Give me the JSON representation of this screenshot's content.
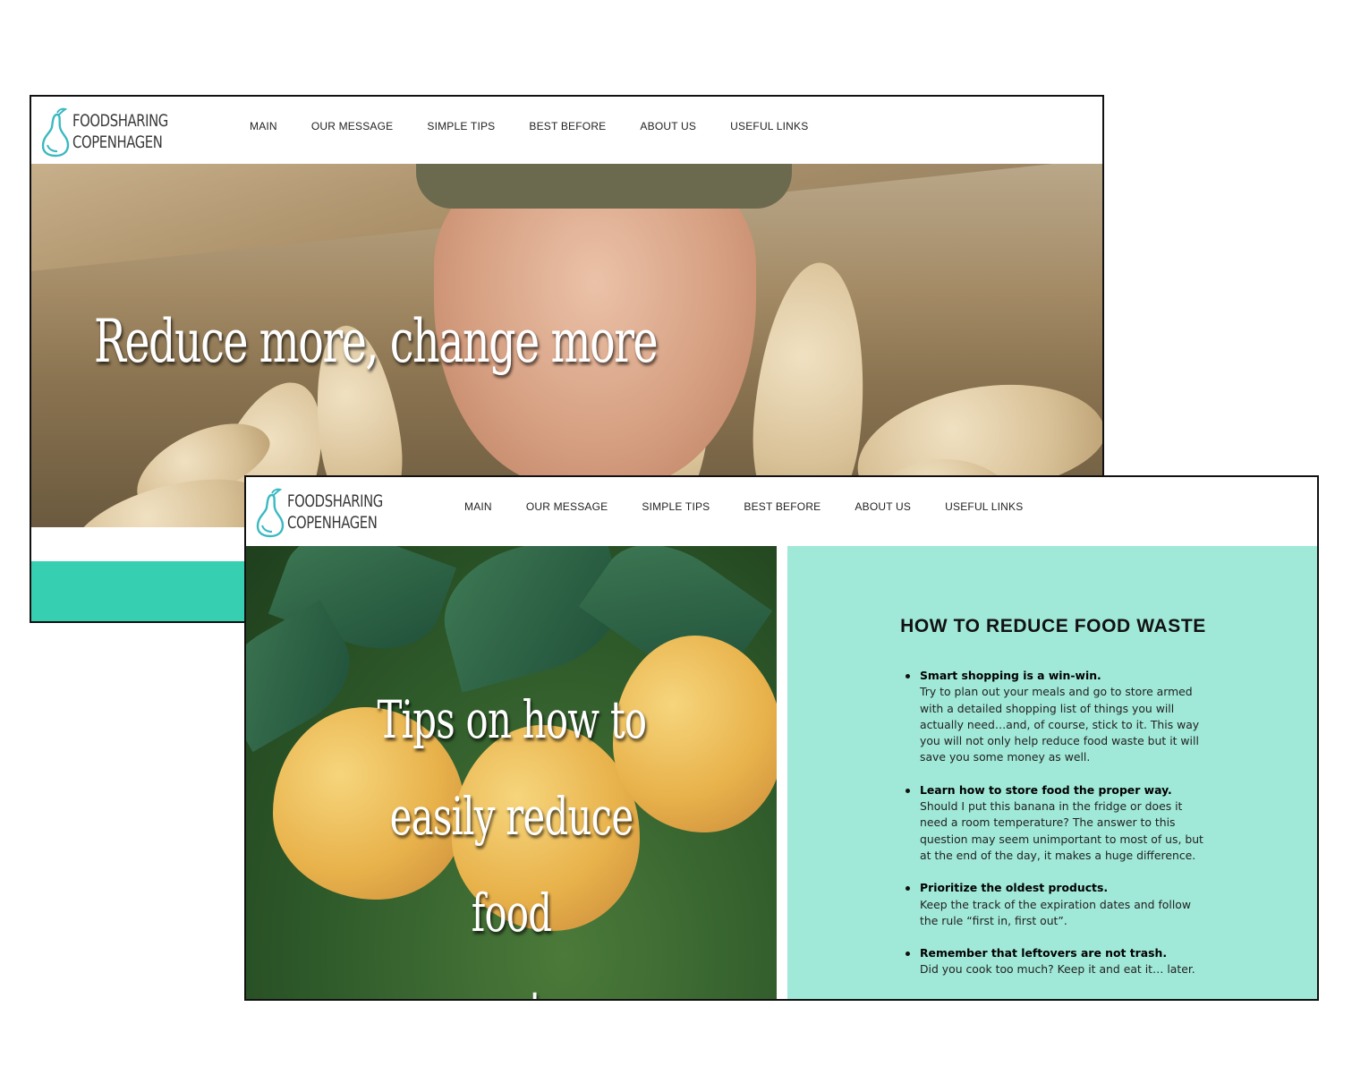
{
  "logo": {
    "line1": "FOODSHARING",
    "line2": "COPENHAGEN"
  },
  "nav": [
    "MAIN",
    "OUR MESSAGE",
    "SIMPLE TIPS",
    "BEST BEFORE",
    "ABOUT US",
    "USEFUL LINKS"
  ],
  "colors": {
    "accent_teal": "#37cfb2",
    "panel_mint": "#a0e8d8",
    "logo_teal": "#3bb9c0"
  },
  "page1": {
    "hero_title": "Reduce more, change more"
  },
  "page2": {
    "hero_title_lines": [
      "Tips on how to",
      "easily reduce food",
      "waste"
    ],
    "panel_title": "HOW TO REDUCE FOOD WASTE",
    "tips": [
      {
        "head": "Smart shopping is a win-win.",
        "body": "Try to plan out your meals and go to store armed with a detailed shopping list of things you will actually need…and, of course, stick to it. This way you will not only help reduce food waste but it will save you some money as well."
      },
      {
        "head": "Learn how to store food the proper way.",
        "body": "Should I put this banana in the fridge or does it need a room temperature? The answer to this question may seem unimportant to most of us, but at the end of the day, it makes a huge difference."
      },
      {
        "head": "Prioritize the oldest products.",
        "body": "Keep the track of the expiration dates and follow the rule “first in, first out”."
      },
      {
        "head": "Remember that leftovers are not trash.",
        "body": "Did you cook too much? Keep it and eat it… later."
      }
    ]
  }
}
